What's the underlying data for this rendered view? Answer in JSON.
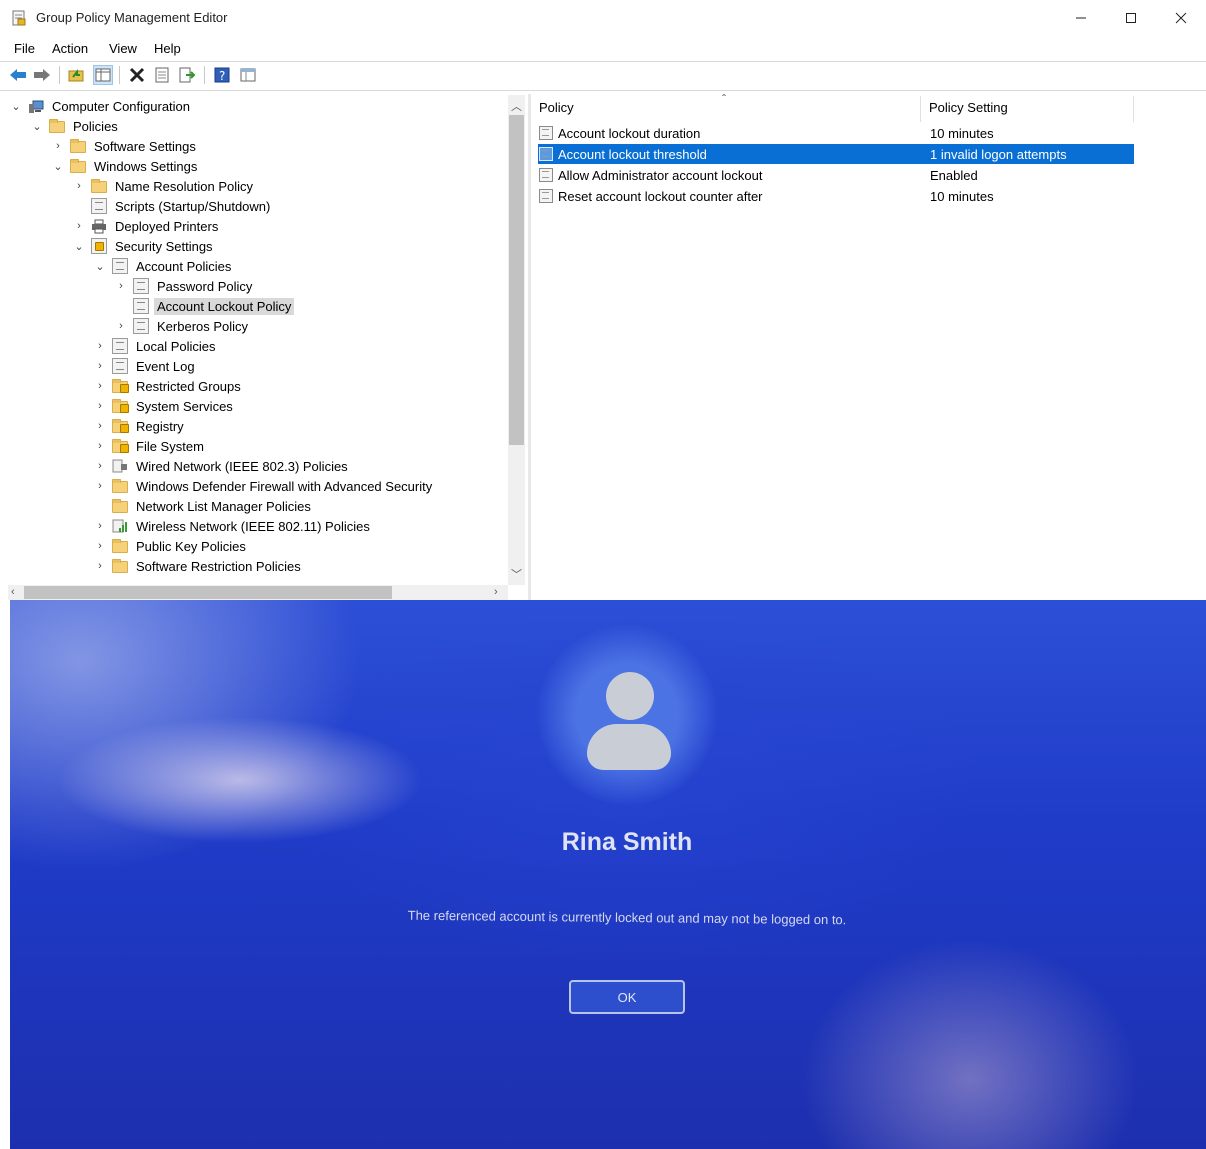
{
  "window": {
    "title": "Group Policy Management Editor",
    "controls": {
      "minimize": "—",
      "maximize": "☐",
      "close": "✕"
    }
  },
  "menu": [
    "File",
    "Action",
    "View",
    "Help"
  ],
  "toolbar": [
    "back-icon",
    "forward-icon",
    "up-folder-icon",
    "show-hide-tree-icon",
    "delete-icon",
    "properties-icon",
    "export-list-icon",
    "help-icon",
    "view-icon"
  ],
  "tree": [
    {
      "label": "Computer Configuration",
      "expander": "⌄",
      "icon": "computer-icon"
    },
    {
      "label": "Policies",
      "expander": "⌄",
      "icon": "folder-icon"
    },
    {
      "label": "Software Settings",
      "expander": "›",
      "icon": "folder-icon"
    },
    {
      "label": "Windows Settings",
      "expander": "⌄",
      "icon": "folder-icon"
    },
    {
      "label": "Name Resolution Policy",
      "expander": "›",
      "icon": "folder-icon"
    },
    {
      "label": "Scripts (Startup/Shutdown)",
      "expander": "",
      "icon": "scripts-icon"
    },
    {
      "label": "Deployed Printers",
      "expander": "›",
      "icon": "printer-icon"
    },
    {
      "label": "Security Settings",
      "expander": "⌄",
      "icon": "security-settings-icon"
    },
    {
      "label": "Account Policies",
      "expander": "⌄",
      "icon": "policy-icon"
    },
    {
      "label": "Password Policy",
      "expander": "›",
      "icon": "policy-icon"
    },
    {
      "label": "Account Lockout Policy",
      "expander": "",
      "icon": "policy-icon",
      "selected": true
    },
    {
      "label": "Kerberos Policy",
      "expander": "›",
      "icon": "policy-icon"
    },
    {
      "label": "Local Policies",
      "expander": "›",
      "icon": "policy-icon"
    },
    {
      "label": "Event Log",
      "expander": "›",
      "icon": "policy-icon"
    },
    {
      "label": "Restricted Groups",
      "expander": "›",
      "icon": "locked-folder-icon"
    },
    {
      "label": "System Services",
      "expander": "›",
      "icon": "locked-folder-icon"
    },
    {
      "label": "Registry",
      "expander": "›",
      "icon": "locked-folder-icon"
    },
    {
      "label": "File System",
      "expander": "›",
      "icon": "locked-folder-icon"
    },
    {
      "label": "Wired Network (IEEE 802.3) Policies",
      "expander": "›",
      "icon": "wired-network-icon"
    },
    {
      "label": "Windows Defender Firewall with Advanced Security",
      "expander": "›",
      "icon": "folder-icon"
    },
    {
      "label": "Network List Manager Policies",
      "expander": "",
      "icon": "folder-icon"
    },
    {
      "label": "Wireless Network (IEEE 802.11) Policies",
      "expander": "›",
      "icon": "wireless-network-icon"
    },
    {
      "label": "Public Key Policies",
      "expander": "›",
      "icon": "folder-icon"
    },
    {
      "label": "Software Restriction Policies",
      "expander": "›",
      "icon": "folder-icon"
    }
  ],
  "list": {
    "columns": [
      "Policy",
      "Policy Setting"
    ],
    "rows": [
      {
        "policy": "Account lockout duration",
        "setting": "10 minutes"
      },
      {
        "policy": "Account lockout threshold",
        "setting": "1 invalid logon attempts",
        "selected": true
      },
      {
        "policy": "Allow Administrator account lockout",
        "setting": "Enabled"
      },
      {
        "policy": "Reset account lockout counter after",
        "setting": "10 minutes"
      }
    ]
  },
  "lock_screen": {
    "user_name": "Rina Smith",
    "message": "The referenced account is currently locked out and may not be logged on to.",
    "ok_label": "OK"
  },
  "colors": {
    "selection": "#0a6fd4",
    "lock_screen_bg": "#1f3cc9"
  }
}
